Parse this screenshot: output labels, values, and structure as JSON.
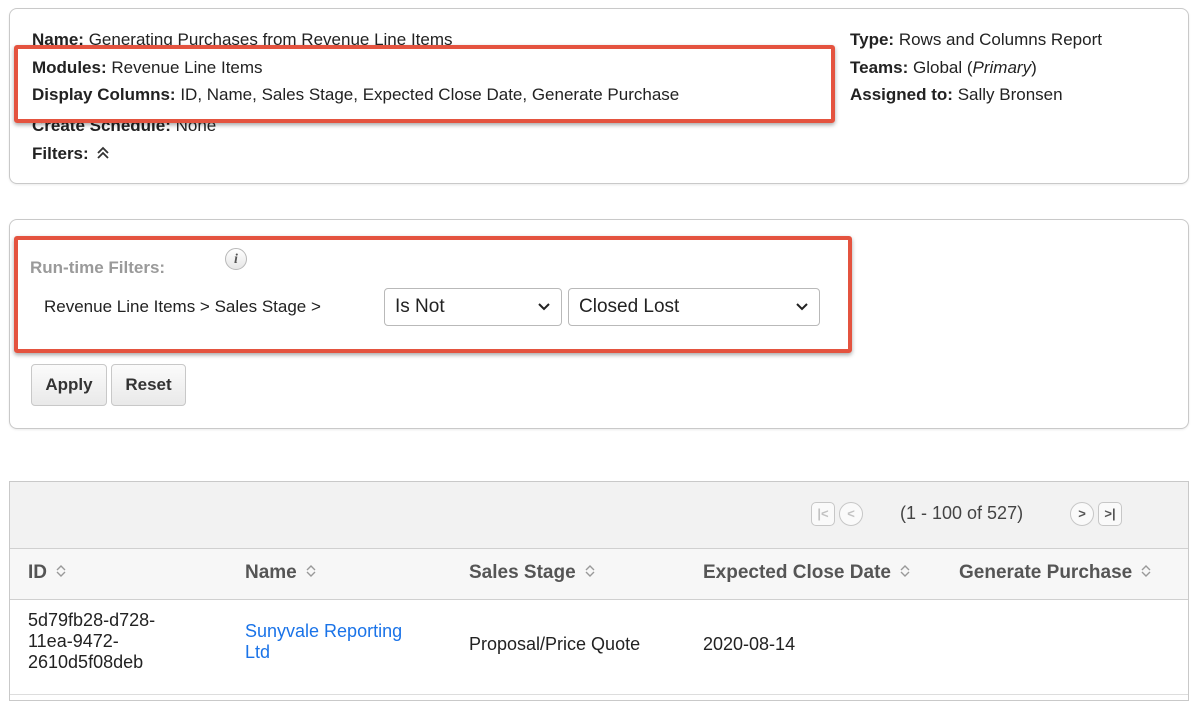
{
  "report_info": {
    "name_label": "Name:",
    "name_value": "Generating Purchases from Revenue Line Items",
    "modules_label": "Modules:",
    "modules_value": "Revenue Line Items",
    "display_columns_label": "Display Columns:",
    "display_columns_value": "ID, Name, Sales Stage, Expected Close Date, Generate Purchase",
    "create_schedule_label": "Create Schedule:",
    "create_schedule_value": "None",
    "filters_label": "Filters:",
    "filters_icon": "double-chevron-up-icon",
    "type_label": "Type:",
    "type_value": "Rows and Columns Report",
    "teams_label": "Teams:",
    "teams_value": "Global (",
    "teams_primary": "Primary",
    "teams_close": ")",
    "assigned_label": "Assigned to:",
    "assigned_value": "Sally Bronsen"
  },
  "runtime_filters": {
    "title": "Run-time Filters:",
    "info_icon_glyph": "i",
    "path": "Revenue Line Items > Sales Stage >",
    "operator": "Is Not",
    "value": "Closed Lost",
    "apply_label": "Apply",
    "reset_label": "Reset"
  },
  "results": {
    "pagination_text": "(1 - 100 of 527)",
    "columns": [
      "ID",
      "Name",
      "Sales Stage",
      "Expected Close Date",
      "Generate Purchase"
    ],
    "rows": [
      {
        "id_line1": "5d79fb28-d728-",
        "id_line2": "11ea-9472-",
        "id_line3": "2610d5f08deb",
        "name_line1": "Sunyvale Reporting",
        "name_line2": "Ltd",
        "sales_stage": "Proposal/Price Quote",
        "expected_close_date": "2020-08-14",
        "generate_purchase": ""
      }
    ]
  },
  "colors": {
    "highlight": "#e4533f",
    "link": "#1a73e8",
    "muted_title": "#9a9a9a"
  }
}
